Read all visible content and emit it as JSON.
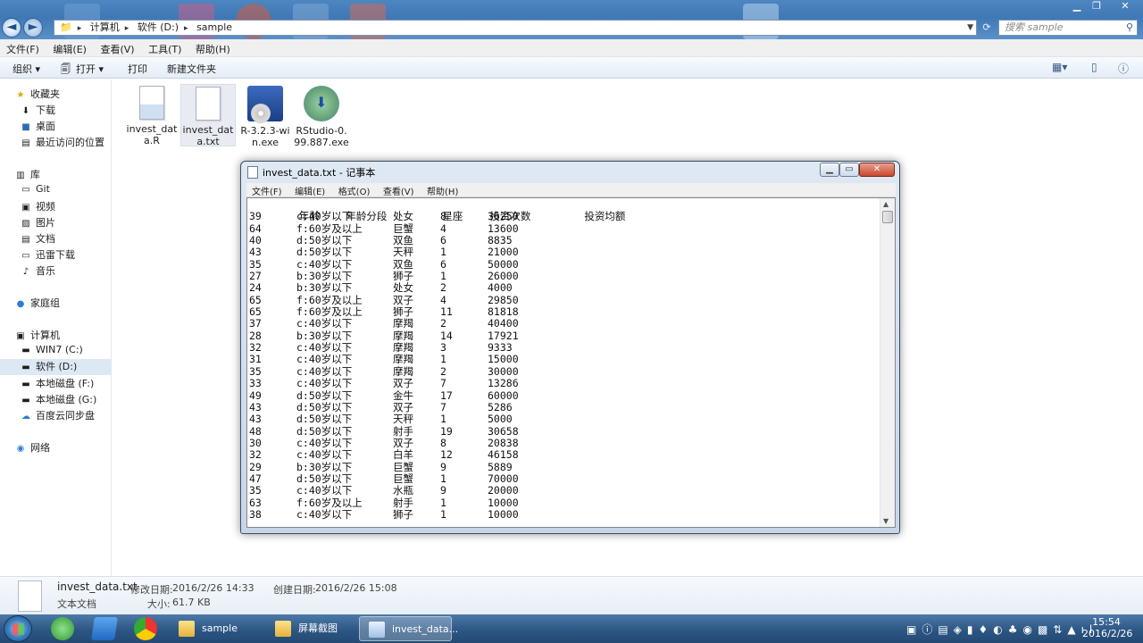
{
  "address": {
    "crumbs": [
      "计算机",
      "软件 (D:)",
      "sample"
    ]
  },
  "search": {
    "placeholder": "搜索 sample"
  },
  "menubar": [
    "文件(F)",
    "编辑(E)",
    "查看(V)",
    "工具(T)",
    "帮助(H)"
  ],
  "toolbar": {
    "organize": "组织 ▾",
    "open": "打开 ▾",
    "print": "打印",
    "new_folder": "新建文件夹"
  },
  "sidebar": {
    "favorites": "收藏夹",
    "downloads": "下载",
    "desktop": "桌面",
    "recent": "最近访问的位置",
    "libraries": "库",
    "git": "Git",
    "videos": "视频",
    "pictures": "图片",
    "documents": "文档",
    "xunlei": "迅雷下载",
    "music": "音乐",
    "homegroup": "家庭组",
    "computer": "计算机",
    "drive_c": "WIN7 (C:)",
    "drive_d": "软件 (D:)",
    "drive_f": "本地磁盘 (F:)",
    "drive_g": "本地磁盘 (G:)",
    "baidu": "百度云同步盘",
    "network": "网络"
  },
  "files": [
    {
      "name": "invest_data.R",
      "icon": "r-script-icon"
    },
    {
      "name": "invest_data.txt",
      "icon": "text-file-icon"
    },
    {
      "name": "R-3.2.3-win.exe",
      "icon": "r-installer-icon"
    },
    {
      "name": "RStudio-0.99.887.exe",
      "icon": "rstudio-installer-icon"
    }
  ],
  "file_labels": {
    "f0": [
      "invest_dat",
      "a.R"
    ],
    "f1": [
      "invest_dat",
      "a.txt"
    ],
    "f2": [
      "R-3.2.3-wi",
      "n.exe"
    ],
    "f3": [
      "RStudio-0.",
      "99.887.exe"
    ]
  },
  "details": {
    "name": "invest_data.txt",
    "modified_label": "修改日期:",
    "modified": "2016/2/26 14:33",
    "created_label": "创建日期:",
    "created": "2016/2/26 15:08",
    "type": "文本文档",
    "size_label": "大小:",
    "size": "61.7 KB"
  },
  "notepad": {
    "title": "invest_data.txt - 记事本",
    "menu": [
      "文件(F)",
      "编辑(E)",
      "格式(O)",
      "查看(V)",
      "帮助(H)"
    ],
    "header": [
      "年龄",
      "年龄分段",
      "星座",
      "投资次数",
      "",
      "投资均额"
    ],
    "rows": [
      [
        "39",
        "c:40岁以下",
        "处女",
        "8",
        "36250"
      ],
      [
        "64",
        "f:60岁及以上",
        "巨蟹",
        "4",
        "13600"
      ],
      [
        "40",
        "d:50岁以下",
        "双鱼",
        "6",
        "8835"
      ],
      [
        "43",
        "d:50岁以下",
        "天秤",
        "1",
        "21000"
      ],
      [
        "35",
        "c:40岁以下",
        "双鱼",
        "6",
        "50000"
      ],
      [
        "27",
        "b:30岁以下",
        "狮子",
        "1",
        "26000"
      ],
      [
        "24",
        "b:30岁以下",
        "处女",
        "2",
        "4000"
      ],
      [
        "65",
        "f:60岁及以上",
        "双子",
        "4",
        "29850"
      ],
      [
        "65",
        "f:60岁及以上",
        "狮子",
        "11",
        "81818"
      ],
      [
        "37",
        "c:40岁以下",
        "摩羯",
        "2",
        "40400"
      ],
      [
        "28",
        "b:30岁以下",
        "摩羯",
        "14",
        "17921"
      ],
      [
        "32",
        "c:40岁以下",
        "摩羯",
        "3",
        "9333"
      ],
      [
        "31",
        "c:40岁以下",
        "摩羯",
        "1",
        "15000"
      ],
      [
        "35",
        "c:40岁以下",
        "摩羯",
        "2",
        "30000"
      ],
      [
        "33",
        "c:40岁以下",
        "双子",
        "7",
        "13286"
      ],
      [
        "49",
        "d:50岁以下",
        "金牛",
        "17",
        "60000"
      ],
      [
        "43",
        "d:50岁以下",
        "双子",
        "7",
        "5286"
      ],
      [
        "43",
        "d:50岁以下",
        "天秤",
        "1",
        "5000"
      ],
      [
        "48",
        "d:50岁以下",
        "射手",
        "19",
        "30658"
      ],
      [
        "30",
        "c:40岁以下",
        "双子",
        "8",
        "20838"
      ],
      [
        "32",
        "c:40岁以下",
        "白羊",
        "12",
        "46158"
      ],
      [
        "29",
        "b:30岁以下",
        "巨蟹",
        "9",
        "5889"
      ],
      [
        "47",
        "d:50岁以下",
        "巨蟹",
        "1",
        "70000"
      ],
      [
        "35",
        "c:40岁以下",
        "水瓶",
        "9",
        "20000"
      ],
      [
        "63",
        "f:60岁及以上",
        "射手",
        "1",
        "10000"
      ],
      [
        "38",
        "c:40岁以下",
        "狮子",
        "1",
        "10000"
      ]
    ]
  },
  "taskbar": {
    "tasks": [
      "sample",
      "屏幕截图",
      "invest_data..."
    ],
    "time": "15:54",
    "date": "2016/2/26"
  }
}
